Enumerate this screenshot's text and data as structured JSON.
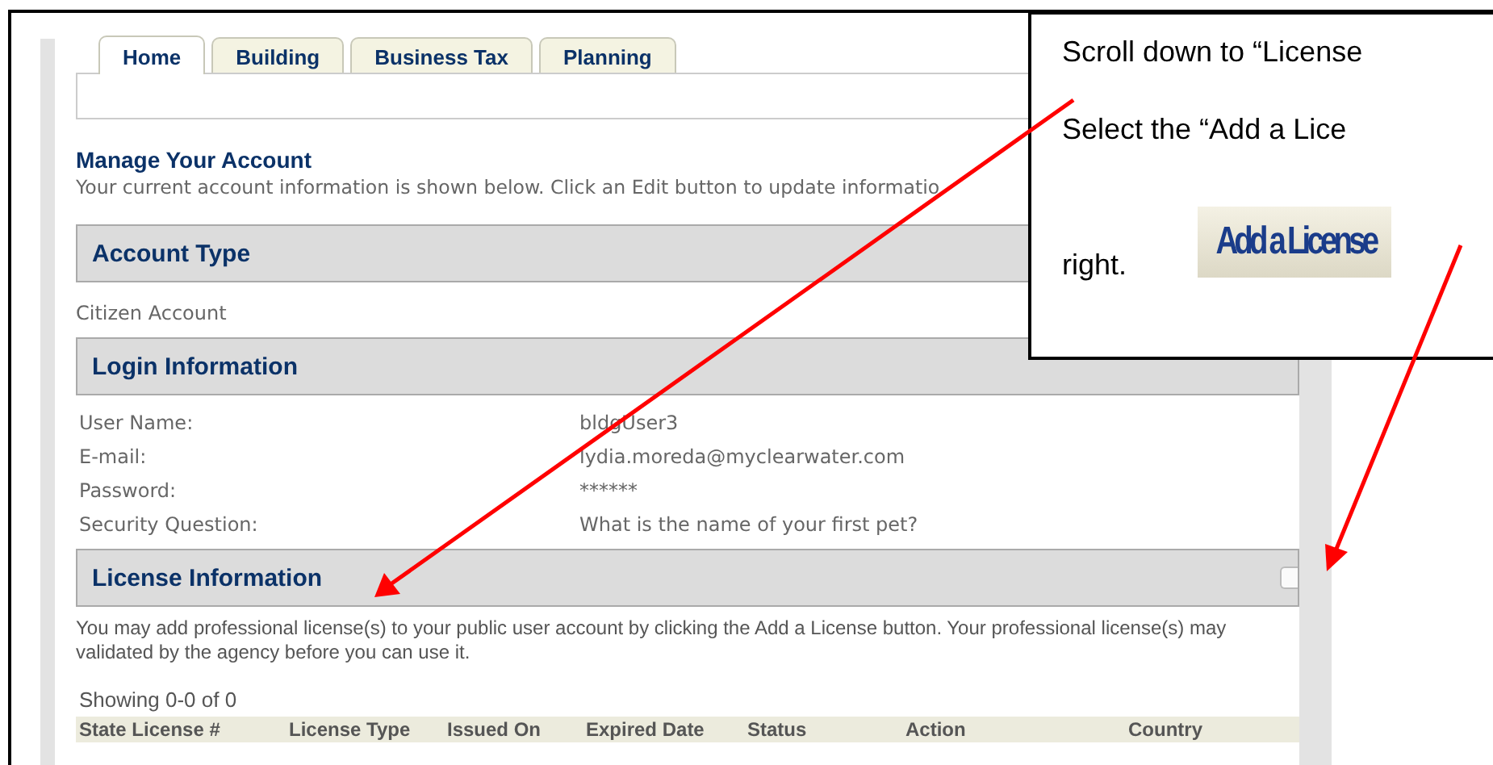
{
  "tabs": [
    {
      "label": "Home",
      "selected": true
    },
    {
      "label": "Building",
      "selected": false
    },
    {
      "label": "Business Tax",
      "selected": false
    },
    {
      "label": "Planning",
      "selected": false
    }
  ],
  "page": {
    "title": "Manage Your Account",
    "description": "Your current account information is shown below. Click an Edit button to update informatio"
  },
  "account_type": {
    "title": "Account Type",
    "value": "Citizen Account"
  },
  "login_information": {
    "title": "Login Information",
    "fields": [
      {
        "label": "User Name:",
        "value": "bldgUser3"
      },
      {
        "label": "E-mail:",
        "value": "lydia.moreda@myclearwater.com"
      },
      {
        "label": "Password:",
        "value": "******"
      },
      {
        "label": "Security Question:",
        "value": "What is the name of your first pet?"
      }
    ]
  },
  "license_information": {
    "title": "License Information",
    "description": "You may add professional license(s) to your public user account by clicking the Add a License button. Your professional license(s) may validated by the agency before you can use it.",
    "showing": "Showing 0-0 of 0",
    "columns": [
      "State License #",
      "License Type",
      "Issued On",
      "Expired Date",
      "Status",
      "Action",
      "Country"
    ]
  },
  "callout": {
    "lines": [
      "Scroll down to “License",
      "Select the “Add a Lice",
      "right."
    ],
    "button_image": "Add a License"
  }
}
